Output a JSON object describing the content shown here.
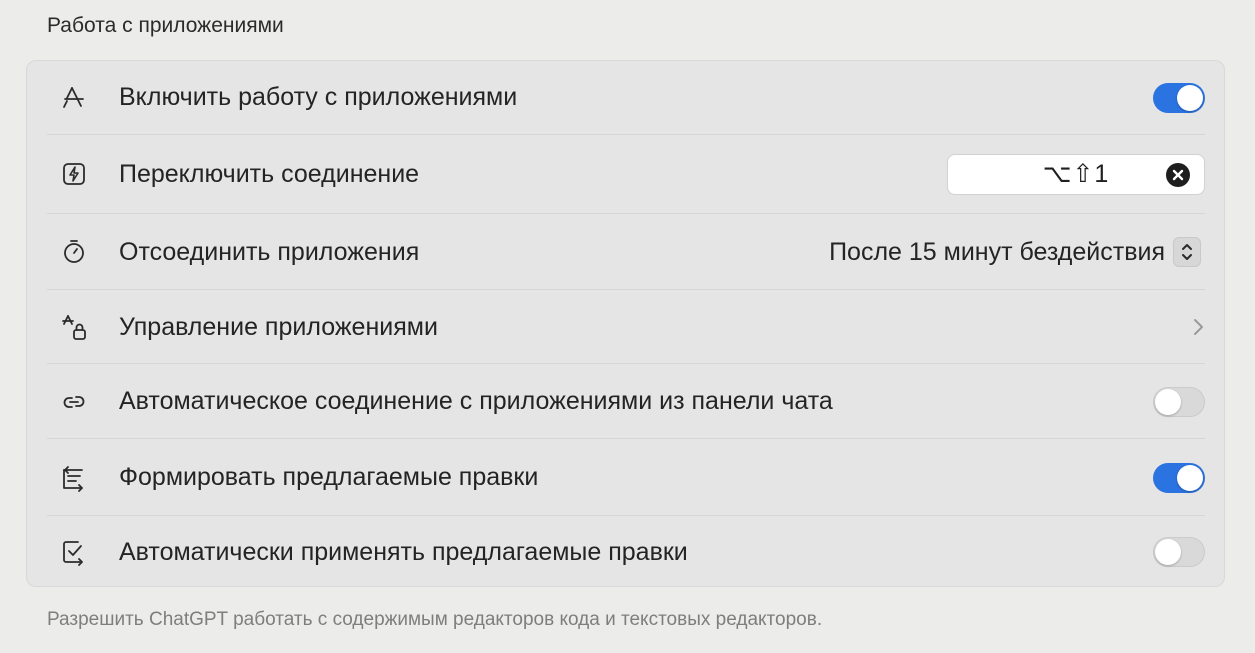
{
  "section": {
    "title": "Работа с приложениями",
    "footer": "Разрешить ChatGPT работать с содержимым редакторов кода и текстовых редакторов."
  },
  "rows": [
    {
      "label": "Включить работу с приложениями",
      "icon": "app-store-icon",
      "control": "toggle",
      "on": true
    },
    {
      "label": "Переключить соединение",
      "icon": "bolt-square-icon",
      "control": "shortcut",
      "shortcut": "⌥⇧1"
    },
    {
      "label": "Отсоединить приложения",
      "icon": "timer-icon",
      "control": "select",
      "value": "После 15 минут бездействия"
    },
    {
      "label": "Управление приложениями",
      "icon": "app-lock-icon",
      "control": "chevron"
    },
    {
      "label": "Автоматическое соединение с приложениями из панели чата",
      "icon": "link-icon",
      "control": "toggle",
      "on": false
    },
    {
      "label": "Формировать предлагаемые правки",
      "icon": "edit-suggestion-icon",
      "control": "toggle",
      "on": true
    },
    {
      "label": "Автоматически применять предлагаемые правки",
      "icon": "check-apply-icon",
      "control": "toggle",
      "on": false
    }
  ],
  "colors": {
    "accent": "#2b73e0",
    "background": "#ececeb",
    "panel": "#e5e5e5"
  }
}
